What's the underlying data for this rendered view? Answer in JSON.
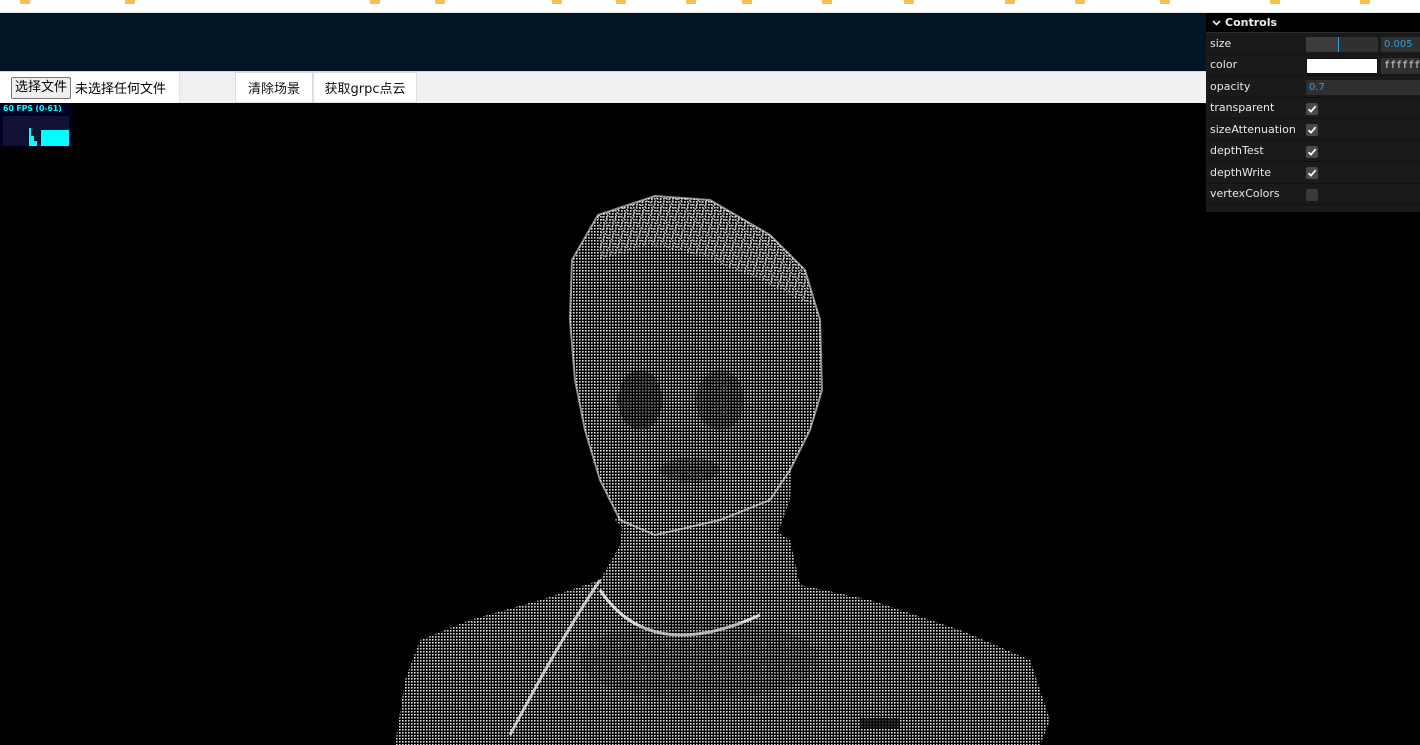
{
  "toolbar": {
    "file_button_label": "选择文件",
    "file_status": "未选择任何文件",
    "clear_button_label": "清除场景",
    "grpc_button_label": "获取grpc点云"
  },
  "stats": {
    "fps_label": "60 FPS (0-61)",
    "color": "#00ffff"
  },
  "controls": {
    "title": "Controls",
    "size": {
      "label": "size",
      "value": "0.005",
      "fraction": 0.44
    },
    "color": {
      "label": "color",
      "value": "ffffff",
      "swatch": "#ffffff"
    },
    "opacity": {
      "label": "opacity",
      "value": "0.7"
    },
    "transparent": {
      "label": "transparent",
      "checked": true
    },
    "sizeAttenuation": {
      "label": "sizeAttenuation",
      "checked": true
    },
    "depthTest": {
      "label": "depthTest",
      "checked": true
    },
    "depthWrite": {
      "label": "depthWrite",
      "checked": true
    },
    "vertexColors": {
      "label": "vertexColors",
      "checked": false
    },
    "accent": "#2fa1d6"
  },
  "scene": {
    "background": "#000000",
    "point_color": "#ffffff"
  }
}
